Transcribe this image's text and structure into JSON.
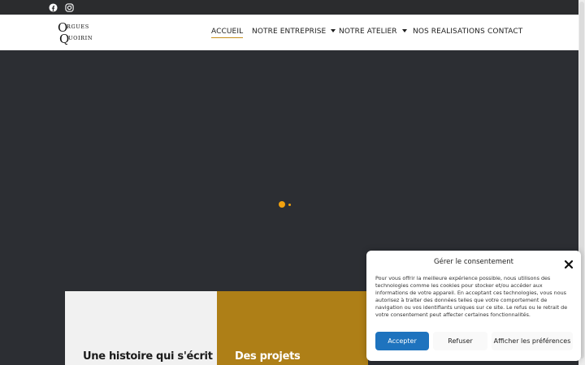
{
  "social": {
    "facebook_icon": "facebook-icon",
    "instagram_icon": "instagram-icon"
  },
  "logo": {
    "line1": "RGUES",
    "line2": "UOIRIN",
    "initial1": "O",
    "initial2": "Q"
  },
  "nav": {
    "items": [
      {
        "label": "ACCUEIL",
        "active": true,
        "dropdown": false
      },
      {
        "label": "NOTRE ENTREPRISE",
        "active": false,
        "dropdown": true
      },
      {
        "label": "NOTRE ATELIER",
        "active": false,
        "dropdown": true
      },
      {
        "label": "NOS REALISATIONS",
        "active": false,
        "dropdown": false
      },
      {
        "label": "CONTACT",
        "active": false,
        "dropdown": false
      }
    ]
  },
  "cards": [
    {
      "title": "Une histoire qui s'écrit"
    },
    {
      "title": "Des projets"
    },
    {
      "title": ""
    }
  ],
  "consent": {
    "title": "Gérer le consentement",
    "text": "Pour vous offrir la meilleure expérience possible, nous utilisons des technologies comme les cookies pour stocker et/ou accéder aux informations de votre appareil. En acceptant ces technologies, vous nous autorisez à traiter des données telles que votre comportement de navigation ou vos identifiants uniques sur ce site. Le refus ou le retrait de votre consentement peut affecter certaines fonctionnalités.",
    "accept_label": "Accepter",
    "refuse_label": "Refuser",
    "prefs_label": "Afficher les préférences"
  },
  "colors": {
    "topbar": "#2b2c2e",
    "hero": "#2c2e33",
    "accent_gold": "#ae7f17",
    "loader": "#f2a20f",
    "accept_button": "#1e73be"
  }
}
